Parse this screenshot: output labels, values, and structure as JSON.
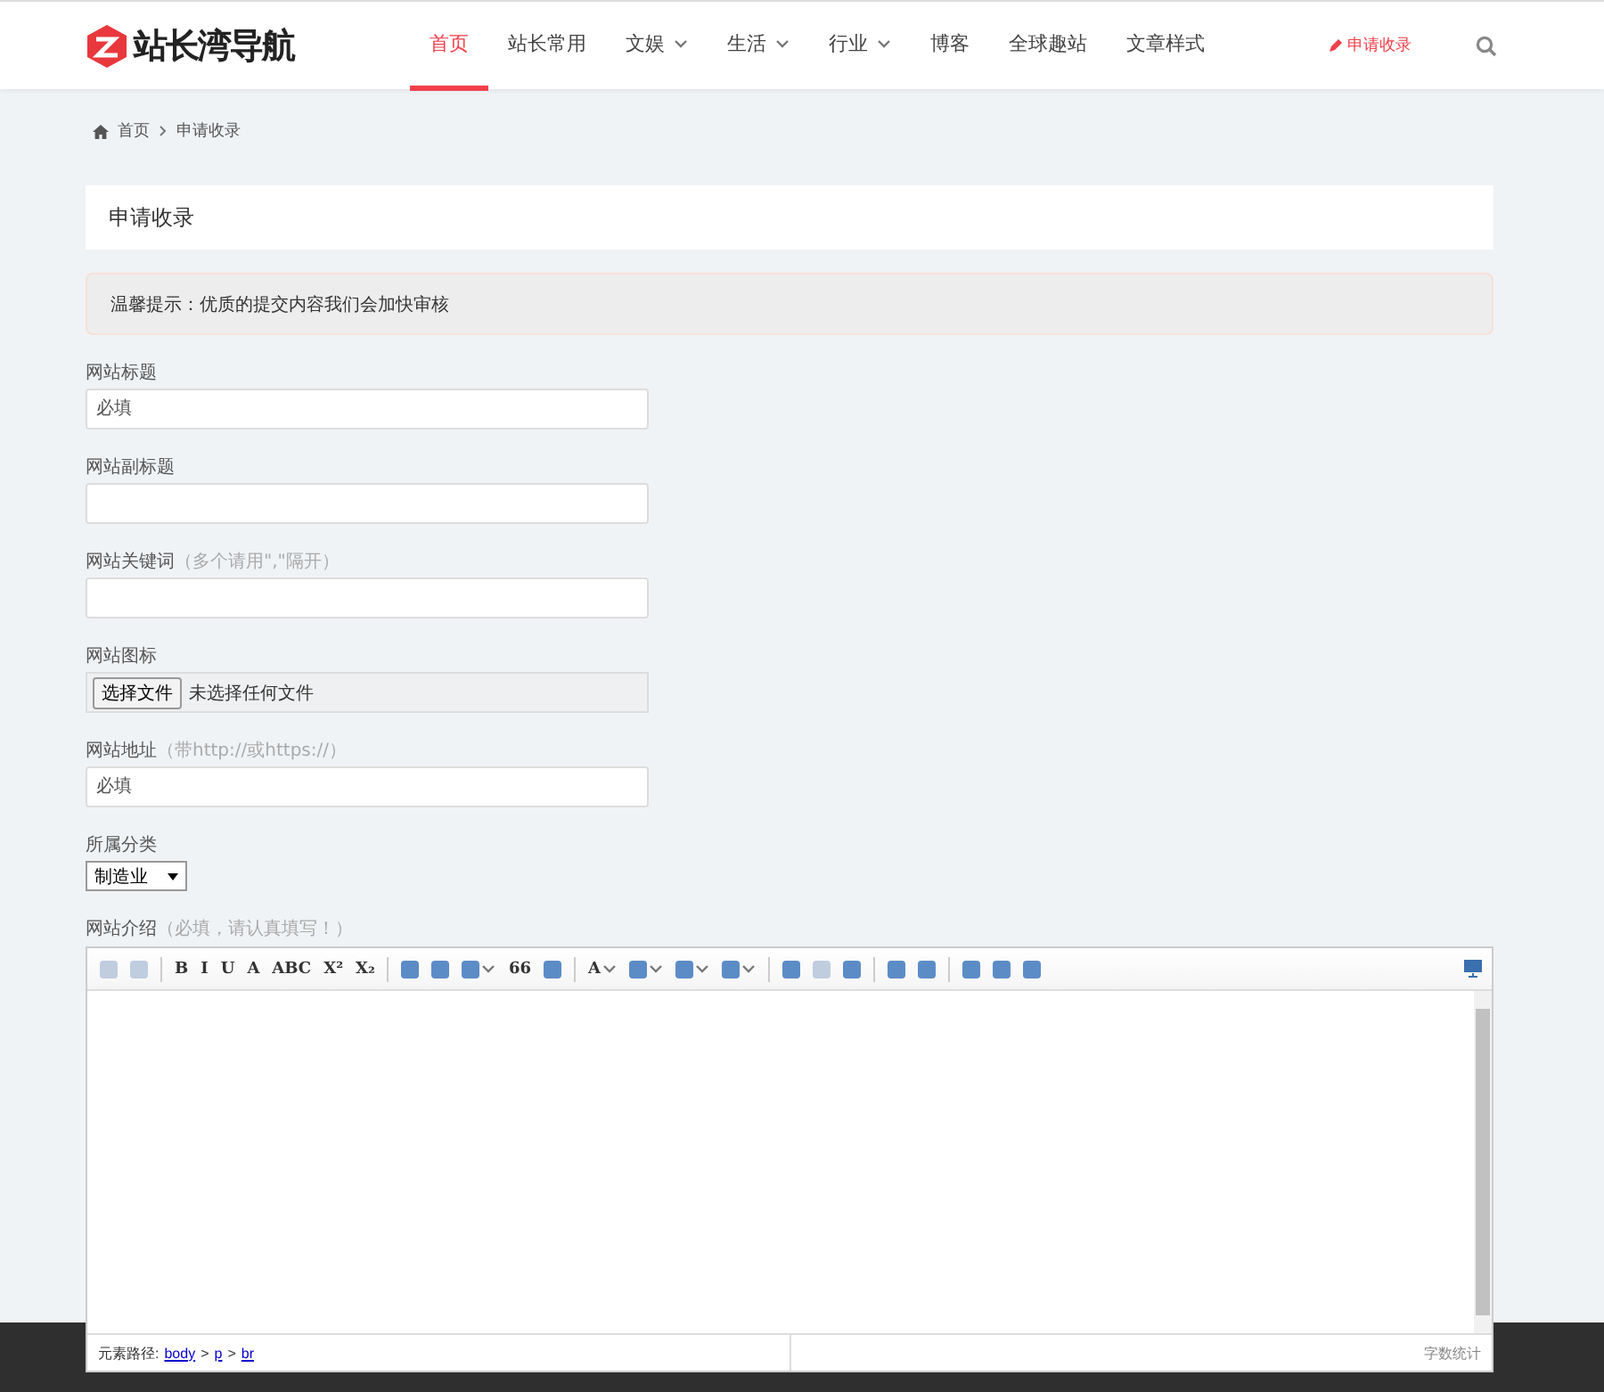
{
  "header": {
    "logo": "站长湾导航",
    "nav": [
      {
        "label": "首页",
        "selected": true,
        "dropdown": false
      },
      {
        "label": "站长常用",
        "selected": false,
        "dropdown": false
      },
      {
        "label": "文娱",
        "selected": false,
        "dropdown": true
      },
      {
        "label": "生活",
        "selected": false,
        "dropdown": true
      },
      {
        "label": "行业",
        "selected": false,
        "dropdown": true
      },
      {
        "label": "博客",
        "selected": false,
        "dropdown": false
      },
      {
        "label": "全球趣站",
        "selected": false,
        "dropdown": false
      },
      {
        "label": "文章样式",
        "selected": false,
        "dropdown": false
      }
    ],
    "submit_link": "申请收录"
  },
  "breadcrumb": [
    "首页",
    "申请收录"
  ],
  "page_title": "申请收录",
  "notice": "温馨提示：优质的提交内容我们会加快审核",
  "fields": [
    {
      "kind": "text",
      "label": "网站标题",
      "placeholder": "必填"
    },
    {
      "kind": "text",
      "label": "网站副标题"
    },
    {
      "kind": "text",
      "label": "网站关键词",
      "hint": "（多个请用\",\"隔开）"
    },
    {
      "kind": "file",
      "label": "网站图标",
      "button": "选择文件",
      "status": "未选择任何文件"
    },
    {
      "kind": "text",
      "label": "网站地址",
      "hint": "（带http://或https://）",
      "placeholder": "必填"
    },
    {
      "kind": "select",
      "label": "所属分类",
      "value": "制造业"
    },
    {
      "kind": "editor",
      "label": "网站介绍",
      "hint": "（必填，请认真填写！）"
    }
  ],
  "editor": {
    "toolbar": [
      {
        "kind": "icon",
        "disabled": true
      },
      {
        "kind": "icon",
        "disabled": true
      },
      {
        "kind": "sep"
      },
      {
        "kind": "text",
        "label": "B"
      },
      {
        "kind": "text",
        "label": "I"
      },
      {
        "kind": "text",
        "label": "U"
      },
      {
        "kind": "text",
        "label": "A"
      },
      {
        "kind": "text",
        "label": "ABC"
      },
      {
        "kind": "text",
        "label": "X²"
      },
      {
        "kind": "text",
        "label": "X₂"
      },
      {
        "kind": "sep"
      },
      {
        "kind": "icon",
        "disabled": false
      },
      {
        "kind": "icon",
        "disabled": false
      },
      {
        "kind": "icon",
        "disabled": false,
        "dropdown": true
      },
      {
        "kind": "text",
        "label": "66"
      },
      {
        "kind": "icon",
        "disabled": false
      },
      {
        "kind": "sep"
      },
      {
        "kind": "text",
        "label": "A",
        "dropdown": true
      },
      {
        "kind": "icon",
        "disabled": false,
        "dropdown": true
      },
      {
        "kind": "icon",
        "disabled": false,
        "dropdown": true
      },
      {
        "kind": "icon",
        "disabled": false,
        "dropdown": true
      },
      {
        "kind": "sep"
      },
      {
        "kind": "icon",
        "disabled": false
      },
      {
        "kind": "icon",
        "disabled": true
      },
      {
        "kind": "icon",
        "disabled": false
      },
      {
        "kind": "sep"
      },
      {
        "kind": "icon",
        "disabled": false
      },
      {
        "kind": "icon",
        "disabled": false
      },
      {
        "kind": "sep"
      },
      {
        "kind": "icon",
        "disabled": false
      },
      {
        "kind": "icon",
        "disabled": false
      },
      {
        "kind": "icon",
        "disabled": false
      }
    ],
    "path_label": "元素路径:",
    "path": [
      "body",
      "p",
      "br"
    ],
    "path_separator": ">",
    "word_count": "字数统计"
  }
}
